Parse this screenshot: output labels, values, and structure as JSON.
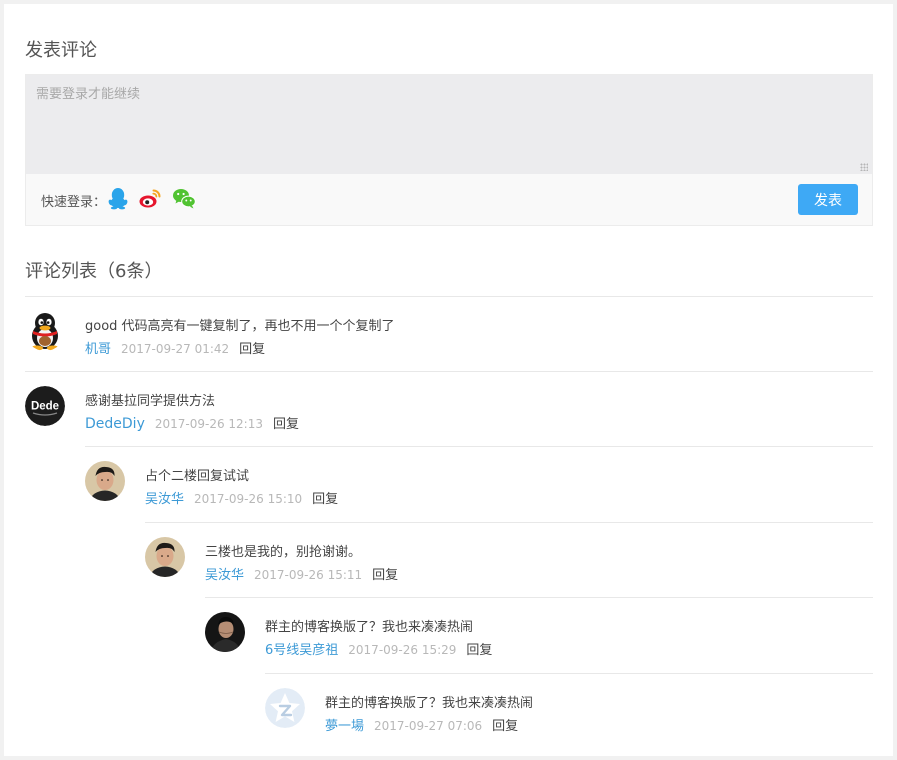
{
  "post": {
    "title": "发表评论",
    "textarea_placeholder": "需要登录才能继续",
    "quick_login_label": "快速登录：",
    "submit_label": "发表"
  },
  "comment_list": {
    "title": "评论列表（6条）"
  },
  "comments": [
    {
      "text": "good 代码高亮有一键复制了，再也不用一个个复制了",
      "author": "机哥",
      "time": "2017-09-27 01:42",
      "reply": "回复",
      "avatar": "qq-penguin"
    },
    {
      "text": "感谢基拉同学提供方法",
      "author": "DedeDiy",
      "time": "2017-09-26 12:13",
      "reply": "回复",
      "avatar": "dede-logo",
      "avatar_label": "Dede"
    },
    {
      "text": "占个二楼回复试试",
      "author": "吴汝华",
      "time": "2017-09-26 15:10",
      "reply": "回复",
      "avatar": "user-photo"
    },
    {
      "text": "三楼也是我的，别抢谢谢。",
      "author": "吴汝华",
      "time": "2017-09-26 15:11",
      "reply": "回复",
      "avatar": "user-photo"
    },
    {
      "text": "群主的博客换版了？我也来凑凑热闹",
      "author": "6号线吴彦祖",
      "time": "2017-09-26 15:29",
      "reply": "回复",
      "avatar": "user-photo-dark"
    },
    {
      "text": "群主的博客换版了？我也来凑凑热闹",
      "author": "夢一場",
      "time": "2017-09-27 07:06",
      "reply": "回复",
      "avatar": "qzone-star"
    }
  ],
  "colors": {
    "accent": "#3ea9f5",
    "link": "#3d9ad6",
    "muted": "#b8b8b8"
  }
}
